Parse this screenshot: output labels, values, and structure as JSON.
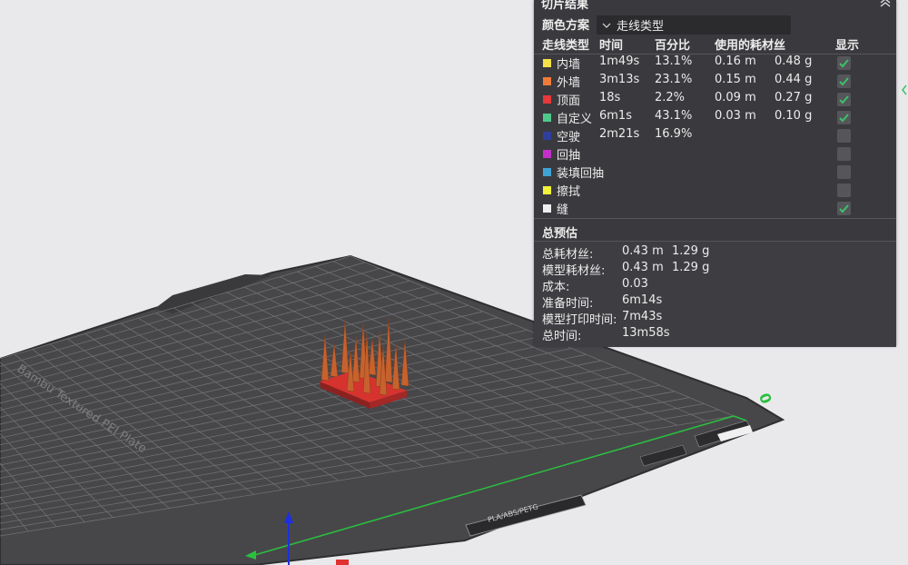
{
  "panel": {
    "title": "切片结果",
    "color_scheme_label": "颜色方案",
    "color_scheme_value": "走线类型",
    "columns": {
      "line_type": "走线类型",
      "time": "时间",
      "percent": "百分比",
      "filament_used": "使用的耗材丝",
      "display": "显示"
    },
    "rows": [
      {
        "name": "内墙",
        "color": "#f5e04a",
        "time": "1m49s",
        "percent": "13.1%",
        "length": "0.16 m",
        "weight": "0.48 g",
        "checked": true
      },
      {
        "name": "外墙",
        "color": "#f07b3a",
        "time": "3m13s",
        "percent": "23.1%",
        "length": "0.15 m",
        "weight": "0.44 g",
        "checked": true
      },
      {
        "name": "顶面",
        "color": "#e8383a",
        "time": "18s",
        "percent": "2.2%",
        "length": "0.09 m",
        "weight": "0.27 g",
        "checked": true
      },
      {
        "name": "自定义",
        "color": "#4fc98a",
        "time": "6m1s",
        "percent": "43.1%",
        "length": "0.03 m",
        "weight": "0.10 g",
        "checked": true
      },
      {
        "name": "空驶",
        "color": "#2e3f9e",
        "time": "2m21s",
        "percent": "16.9%",
        "length": "",
        "weight": "",
        "checked": false
      },
      {
        "name": "回抽",
        "color": "#c42fc9",
        "time": "",
        "percent": "",
        "length": "",
        "weight": "",
        "checked": false
      },
      {
        "name": "装填回抽",
        "color": "#3fa3d6",
        "time": "",
        "percent": "",
        "length": "",
        "weight": "",
        "checked": false
      },
      {
        "name": "擦拭",
        "color": "#f2f23a",
        "time": "",
        "percent": "",
        "length": "",
        "weight": "",
        "checked": false
      },
      {
        "name": "缝",
        "color": "#eeeeee",
        "time": "",
        "percent": "",
        "length": "",
        "weight": "",
        "checked": true
      }
    ],
    "estimate": {
      "title": "总预估",
      "rows": [
        {
          "label": "总耗材丝:",
          "value": "0.43 m",
          "value2": "1.29 g"
        },
        {
          "label": "模型耗材丝:",
          "value": "0.43 m",
          "value2": "1.29 g"
        },
        {
          "label": "成本:",
          "value": "0.03",
          "value2": ""
        },
        {
          "label": "准备时间:",
          "value": "6m14s",
          "value2": ""
        },
        {
          "label": "模型打印时间:",
          "value": "7m43s",
          "value2": ""
        },
        {
          "label": "总时间:",
          "value": "13m58s",
          "value2": ""
        }
      ]
    }
  },
  "plate": {
    "brand_text": "Bambu Textured PEI Plate",
    "corner_number": "0",
    "plate_label": "PLA/ABS/PETG"
  },
  "colors": {
    "panel_bg": "#3a3a3e",
    "plate": "#47474a",
    "grid": "#6a6a6c",
    "check": "#3cc06a",
    "model_base": "#c9302c",
    "model_spike": "#c6622e"
  }
}
